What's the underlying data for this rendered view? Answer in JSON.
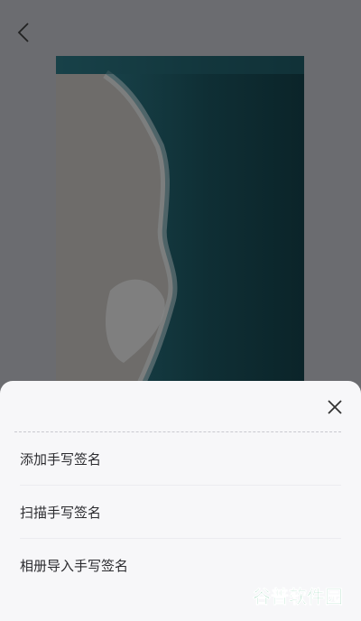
{
  "menu": {
    "items": [
      {
        "label": "添加手写签名"
      },
      {
        "label": "扫描手写签名"
      },
      {
        "label": "相册导入手写签名"
      }
    ]
  },
  "watermark": {
    "text": "谷普软件园"
  },
  "icons": {
    "back": "chevron-left-icon",
    "close": "close-icon"
  },
  "colors": {
    "overlay": "#6b6c70",
    "sheet": "#f7f7f9",
    "ocean": "#0f2f35",
    "sand": "#6e6c6a",
    "watermark_primary": "#2aa66b",
    "watermark_accent": "#f29a1a"
  }
}
